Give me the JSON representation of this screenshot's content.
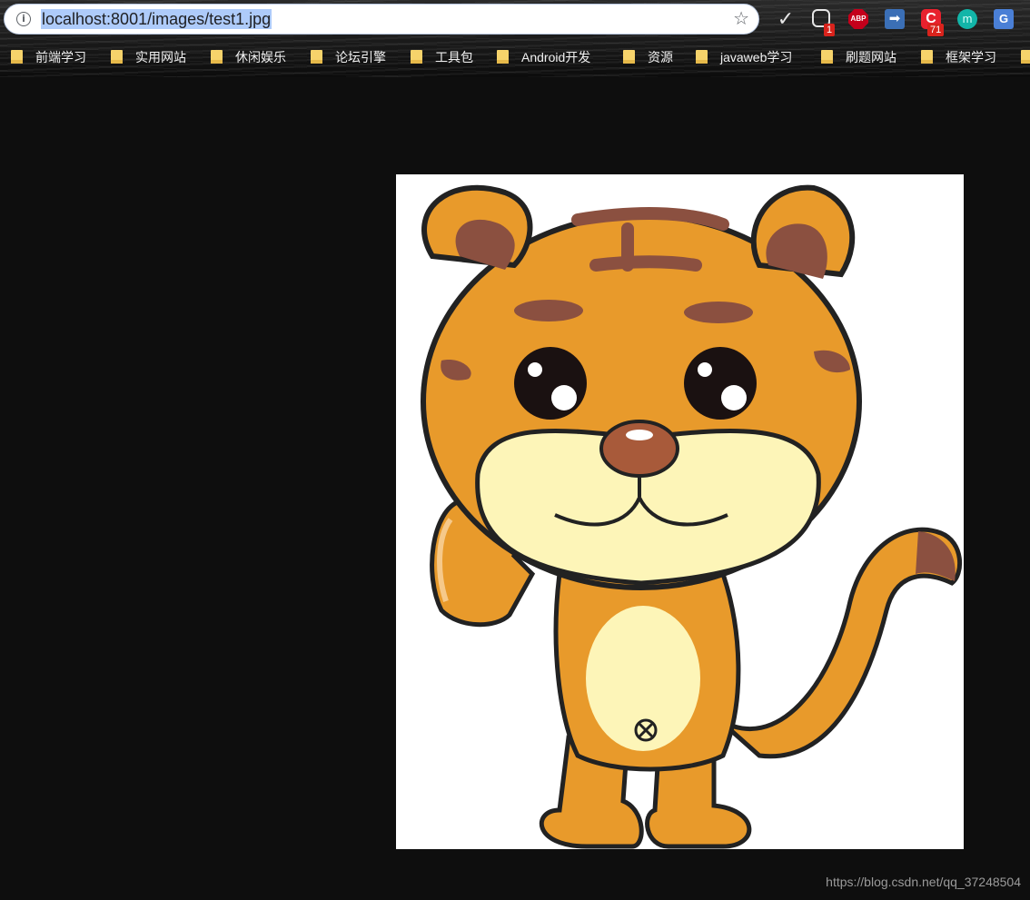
{
  "address_bar": {
    "url": "localhost:8001/images/test1.jpg"
  },
  "extensions": {
    "badge_one": "1",
    "abp_label": "ABP",
    "badge_seventy_one": "71"
  },
  "bookmarks": [
    {
      "label": "前端学习"
    },
    {
      "label": "实用网站"
    },
    {
      "label": "休闲娱乐"
    },
    {
      "label": "论坛引擎"
    },
    {
      "label": "工具包"
    },
    {
      "label": "Android开发"
    },
    {
      "label": "资源"
    },
    {
      "label": "javaweb学习"
    },
    {
      "label": "刷题网站"
    },
    {
      "label": "框架学习"
    }
  ],
  "watermark": "https://blog.csdn.net/qq_37248504",
  "colors": {
    "page_background": "#0e0e0e",
    "tiger_orange": "#e89a2b",
    "tiger_stripe": "#8b5040",
    "tiger_cream": "#fdf5b8"
  }
}
